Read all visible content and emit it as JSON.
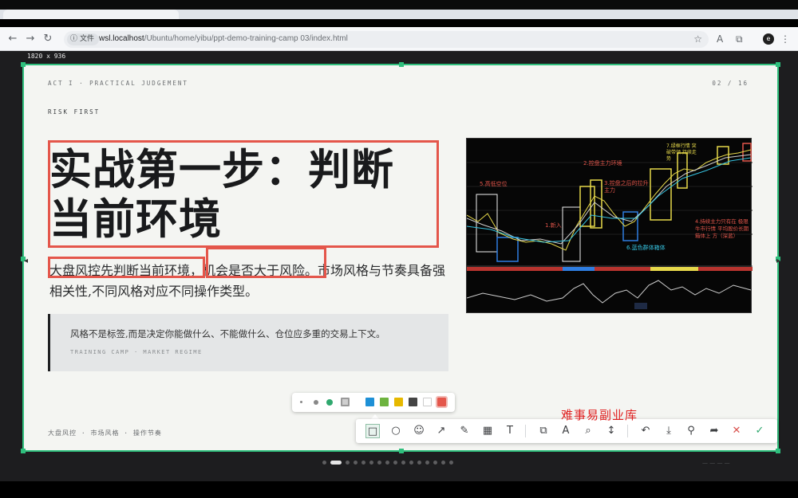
{
  "browser": {
    "site_label": "文件",
    "url_host": "wsl.localhost",
    "url_path": "/Ubuntu/home/yibu/ppt-demo-training-camp 03/index.html",
    "profile_initial": "e"
  },
  "viewport_readout": "1820 x 936",
  "slide": {
    "kicker": "ACT I · PRACTICAL JUDGEMENT",
    "page": "02 / 16",
    "section": "RISK FIRST",
    "title_line1": "实战第一步：判断",
    "title_line2": "当前环境",
    "body_part1": "大盘风控先判断当前环境",
    "body_part2": "，机会是否大于风险。",
    "body_part3": "市场风格与节奏具备强相关性,不同风格对应不同操作类型。",
    "quote": "风格不是标签,而是决定你能做什么、不能做什么、仓位应多重的交易上下文。",
    "quote_caption": "TRAINING CAMP · MARKET REGIME",
    "tags": "大盘风控 · 市场风格 · 操作节奏"
  },
  "chart_image": {
    "labels": [
      "5.高低空位",
      "1.新入",
      "2.控盘主力环境",
      "3.控盘之后的拉升主力",
      "6.蓝色群体箱体",
      "7.绿框行情 突破带领 持续走势",
      "4.持续主力只有在 极限牛市行情 平均股价长期箱体上 方（深蓝）"
    ]
  },
  "palette": {
    "colors": [
      "#1e90d6",
      "#6db33f",
      "#e6b800",
      "#444444",
      "#ffffff",
      "#e4564b"
    ]
  },
  "annotation_toolbar": {
    "tools": [
      "rectangle-tool",
      "ellipse-tool",
      "emoji-tool",
      "arrow-tool",
      "pen-tool",
      "mosaic-tool",
      "text-tool",
      "pin-tool",
      "ocr-tool",
      "magnify-tool",
      "long-screenshot-tool",
      "undo",
      "save",
      "pin-to-screen",
      "share",
      "cancel",
      "confirm"
    ]
  },
  "watermark": "难事易副业库",
  "pager": {
    "total": 16,
    "current": 2
  }
}
